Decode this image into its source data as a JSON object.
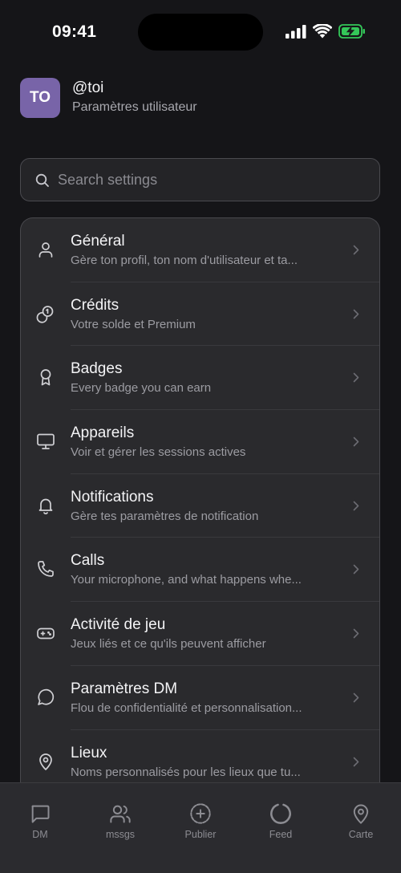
{
  "status_bar": {
    "time": "09:41"
  },
  "profile": {
    "avatar_initials": "TO",
    "avatar_color": "#7864a8",
    "handle": "@toi",
    "subtitle": "Paramètres utilisateur"
  },
  "search": {
    "placeholder": "Search settings",
    "value": ""
  },
  "settings": [
    {
      "title": "Général",
      "subtitle": "Gère ton profil, ton nom d'utilisateur et ta...",
      "icon": "user-icon"
    },
    {
      "title": "Crédits",
      "subtitle": "Votre solde et Premium",
      "icon": "coins-icon"
    },
    {
      "title": "Badges",
      "subtitle": "Every badge you can earn",
      "icon": "award-icon"
    },
    {
      "title": "Appareils",
      "subtitle": "Voir et gérer les sessions actives",
      "icon": "monitor-icon"
    },
    {
      "title": "Notifications",
      "subtitle": "Gère tes paramètres de notification",
      "icon": "bell-icon"
    },
    {
      "title": "Calls",
      "subtitle": "Your microphone, and what happens whe...",
      "icon": "phone-icon"
    },
    {
      "title": "Activité de jeu",
      "subtitle": "Jeux liés et ce qu'ils peuvent afficher",
      "icon": "gamepad-icon"
    },
    {
      "title": "Paramètres DM",
      "subtitle": "Flou de confidentialité et personnalisation...",
      "icon": "chat-bubble-icon"
    },
    {
      "title": "Lieux",
      "subtitle": "Noms personnalisés pour les lieux que tu...",
      "icon": "map-pin-icon"
    }
  ],
  "tabs": [
    {
      "label": "DM",
      "icon": "message-square-icon"
    },
    {
      "label": "mssgs",
      "icon": "users-icon"
    },
    {
      "label": "Publier",
      "icon": "plus-circle-icon"
    },
    {
      "label": "Feed",
      "icon": "circle-icon"
    },
    {
      "label": "Carte",
      "icon": "map-pin-icon"
    }
  ],
  "colors": {
    "background": "#151518",
    "card": "#2a2a2d",
    "battery": "#34c759",
    "text_secondary": "#9c9ca2"
  }
}
